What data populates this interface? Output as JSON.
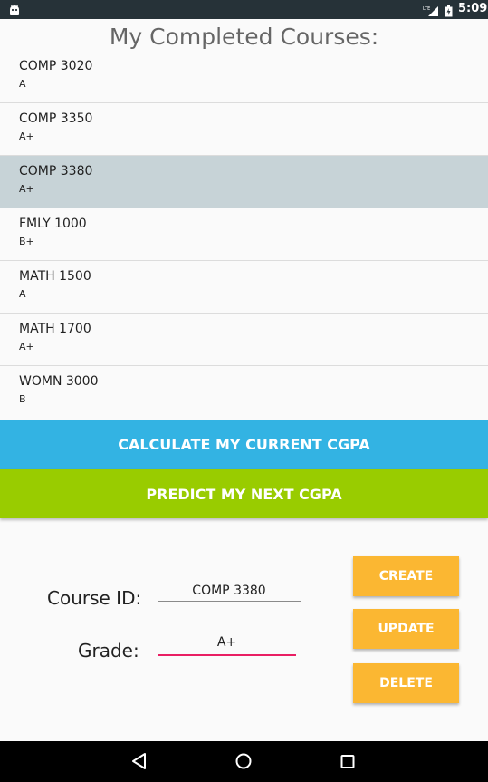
{
  "status_bar": {
    "time": "5:09",
    "network": "LTE"
  },
  "title": "My Completed Courses:",
  "courses": [
    {
      "id": "COMP 3020",
      "grade": "A"
    },
    {
      "id": "COMP 3350",
      "grade": "A+"
    },
    {
      "id": "COMP 3380",
      "grade": "A+",
      "selected": true
    },
    {
      "id": "FMLY 1000",
      "grade": "B+"
    },
    {
      "id": "MATH 1500",
      "grade": "A"
    },
    {
      "id": "MATH 1700",
      "grade": "A+"
    },
    {
      "id": "WOMN 3000",
      "grade": "B"
    }
  ],
  "buttons": {
    "calculate": "CALCULATE MY CURRENT CGPA",
    "predict": "PREDICT MY NEXT CGPA",
    "create": "CREATE",
    "update": "UPDATE",
    "delete": "DELETE"
  },
  "form": {
    "course_id_label": "Course ID:",
    "course_id_value": "COMP 3380",
    "grade_label": "Grade:",
    "grade_value": "A+"
  },
  "colors": {
    "status_bar": "#263238",
    "calculate_button": "#33b3e3",
    "predict_button": "#99cc00",
    "action_button": "#fbb732",
    "selected_row": "#c7d3d7",
    "focused_underline": "#e91e63"
  },
  "icons": {
    "status_left": "android-debug-icon",
    "signal": "lte-signal-icon",
    "battery": "battery-charging-icon",
    "nav_back": "back-triangle-icon",
    "nav_home": "home-circle-icon",
    "nav_recents": "recents-square-icon"
  }
}
